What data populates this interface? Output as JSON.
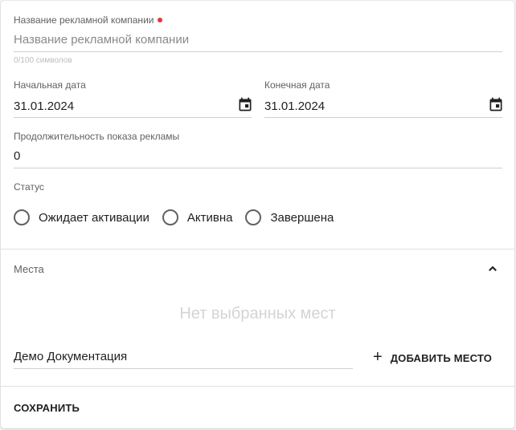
{
  "form": {
    "name_label": "Название рекламной компании",
    "name_placeholder": "Название рекламной компании",
    "name_value": "",
    "name_hint": "0/100 символов",
    "required_color": "#e53935",
    "start_date_label": "Начальная дата",
    "start_date_value": "31.01.2024",
    "end_date_label": "Конечная дата",
    "end_date_value": "31.01.2024",
    "duration_label": "Продолжительность показа рекламы",
    "duration_value": "0",
    "status_label": "Статус",
    "status_options": [
      {
        "label": "Ожидает активации",
        "selected": false
      },
      {
        "label": "Активна",
        "selected": false
      },
      {
        "label": "Завершена",
        "selected": false
      }
    ]
  },
  "places": {
    "title": "Места",
    "expanded": true,
    "empty_text": "Нет выбранных мест",
    "place_value": "Демо Документация",
    "add_button_label": "ДОБАВИТЬ МЕСТО"
  },
  "actions": {
    "save_label": "СОХРАНИТЬ"
  },
  "icons": {
    "calendar": "calendar-icon",
    "chevron": "chevron-up-icon",
    "add": "plus-icon"
  }
}
